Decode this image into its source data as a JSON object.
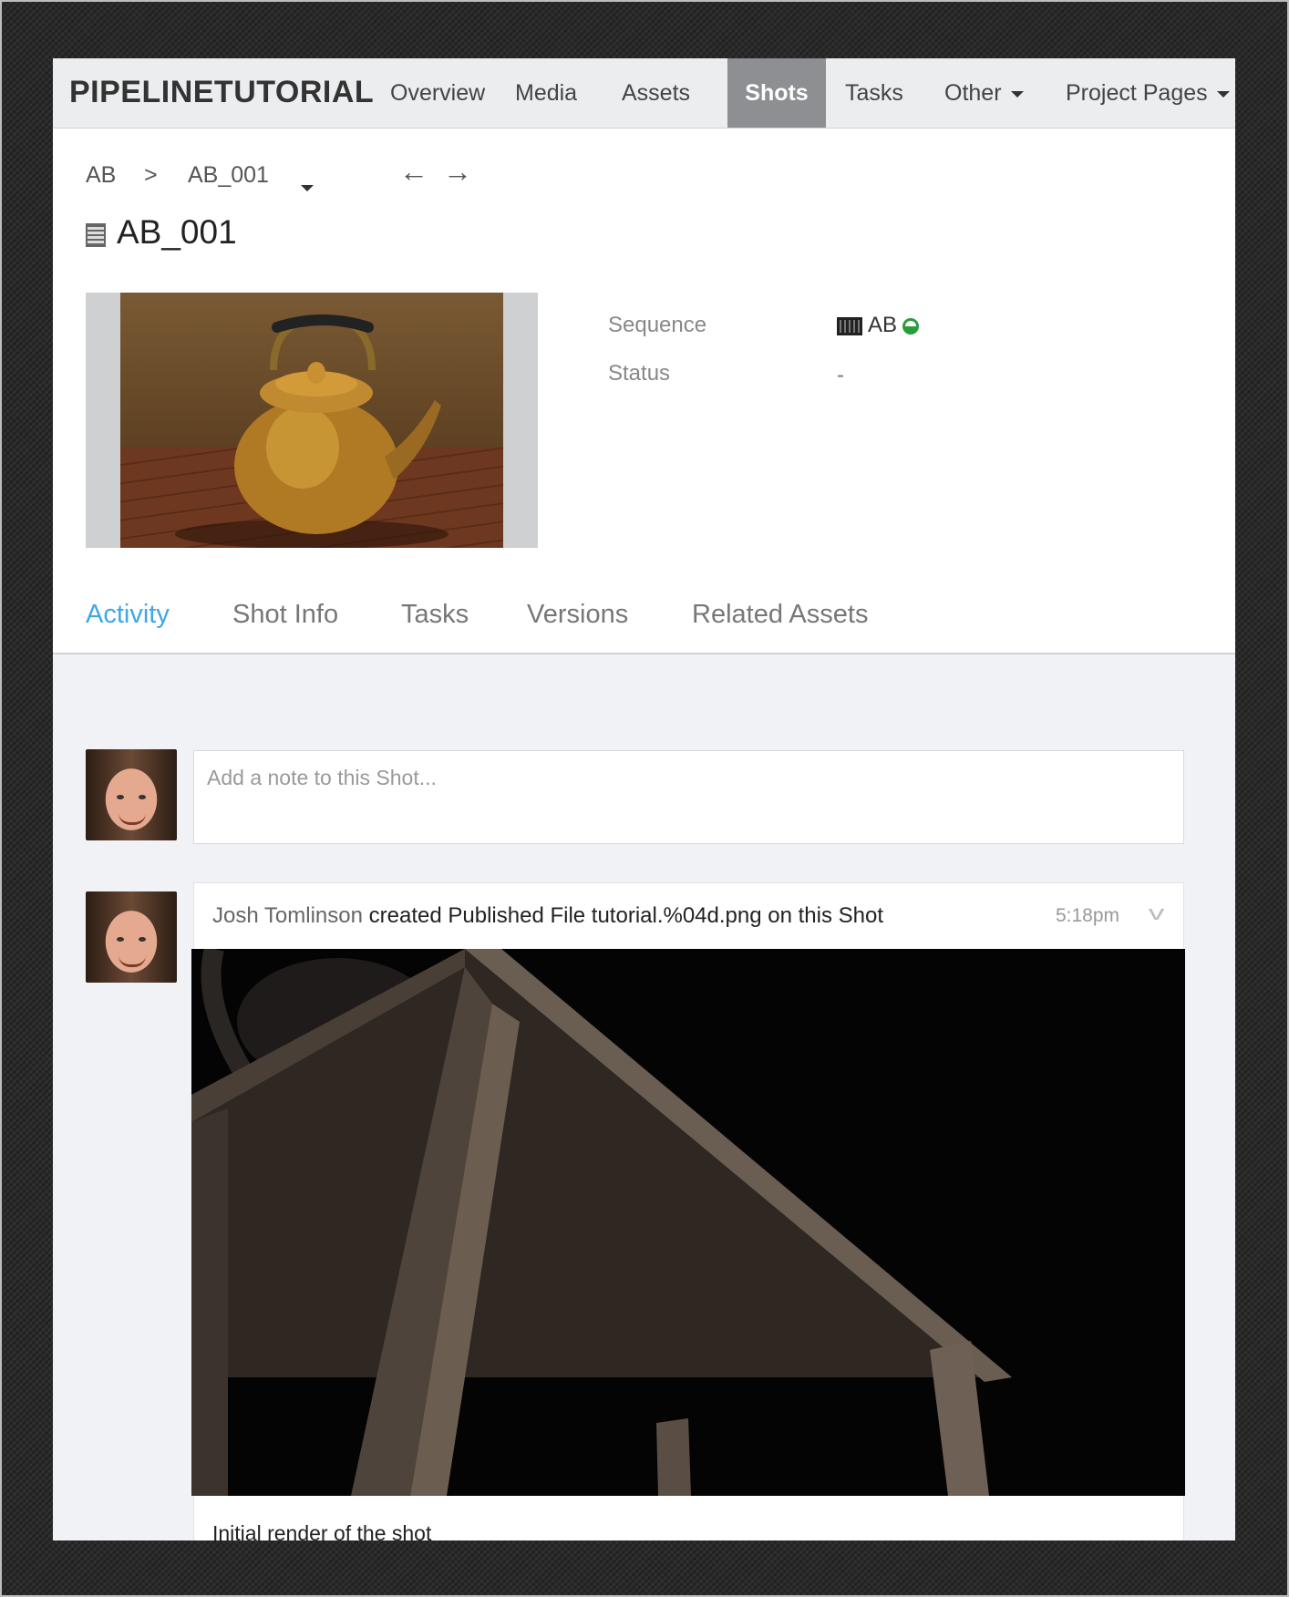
{
  "nav": {
    "brand": "PIPELINETUTORIAL",
    "items": [
      {
        "label": "Overview"
      },
      {
        "label": "Media"
      },
      {
        "label": "Assets"
      },
      {
        "label": "Shots",
        "active": true
      },
      {
        "label": "Tasks"
      },
      {
        "label": "Other"
      },
      {
        "label": "Project Pages"
      }
    ]
  },
  "breadcrumb": {
    "parent": "AB",
    "separator": ">",
    "current": "AB_001",
    "prev_arrow": "←",
    "next_arrow": "→"
  },
  "title": "AB_001",
  "fields": {
    "sequence_label": "Sequence",
    "sequence_value": "AB",
    "status_label": "Status",
    "status_value": "-"
  },
  "tabs": [
    {
      "label": "Activity",
      "active": true
    },
    {
      "label": "Shot Info"
    },
    {
      "label": "Tasks"
    },
    {
      "label": "Versions"
    },
    {
      "label": "Related Assets"
    }
  ],
  "note": {
    "placeholder": "Add a note to this Shot..."
  },
  "activity_item": {
    "author": "Josh Tomlinson",
    "action": "created Published File tutorial.%04d.png on this Shot",
    "time": "5:18pm",
    "caption": "Initial render of the shot"
  },
  "colors": {
    "accent": "#3ea7e8",
    "active_nav": "#8e8f92",
    "status_ok": "#2a9d3b"
  },
  "icons": {
    "expand": "chevron-down-icon",
    "sequence": "film-icon",
    "shot": "film-icon"
  }
}
